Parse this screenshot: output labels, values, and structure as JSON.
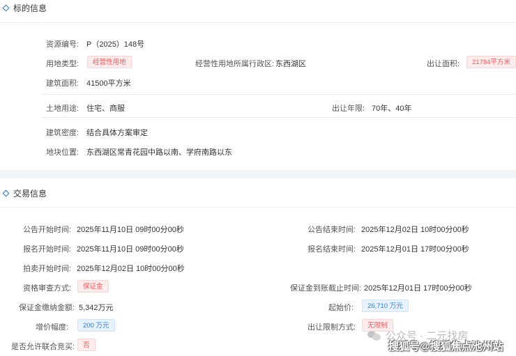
{
  "section1": {
    "title": "标的信息",
    "rows": [
      {
        "label": "资源编号:",
        "value": "P（2025）148号"
      },
      {
        "label": "用地类型:",
        "tag": "经营性用地"
      },
      {
        "label": "经营性用地所属行政区:",
        "value": "东西湖区"
      },
      {
        "label": "出让面积:",
        "tag": "21784平方米"
      },
      {
        "label": "建筑面积:",
        "value": "41500平方米"
      },
      {
        "label": "土地用途:",
        "value": "住宅、商服"
      },
      {
        "label": "出让年限:",
        "value": "70年、40年"
      },
      {
        "label": "建筑密度:",
        "value": "结合具体方案审定"
      },
      {
        "label": "地块位置:",
        "value": "东西湖区常青花园中路以南、学府南路以东"
      }
    ]
  },
  "section2": {
    "title": "交易信息",
    "rows": [
      {
        "label": "公告开始时间:",
        "value": "2025年11月10日 09时00分00秒"
      },
      {
        "label": "公告结束时间:",
        "value": "2025年12月02日 10时00分00秒"
      },
      {
        "label": "报名开始时间:",
        "value": "2025年11月10日 09时00分00秒"
      },
      {
        "label": "报名结束时间:",
        "value": "2025年12月01日 17时00分00秒"
      },
      {
        "label": "拍卖开始时间:",
        "value": "2025年12月02日 10时00分00秒"
      },
      {
        "label": "资格审查方式:",
        "tag": "保证金"
      },
      {
        "label": "保证金到账截止时间:",
        "value": "2025年12月01日 17时00分00秒"
      },
      {
        "label": "保证金缴纳金额:",
        "value": "5,342万元"
      },
      {
        "label": "起始价:",
        "tag": "26,710 万元"
      },
      {
        "label": "增价幅度:",
        "tag": "200 万元"
      },
      {
        "label": "出让限制方式:",
        "tag": "无限制"
      },
      {
        "label": "是否允许联合竞买:",
        "tag": "否"
      }
    ]
  },
  "watermark": {
    "line1": "公众号 · 二元找房",
    "line2": "搜狐号@搜狐焦点池州站"
  }
}
